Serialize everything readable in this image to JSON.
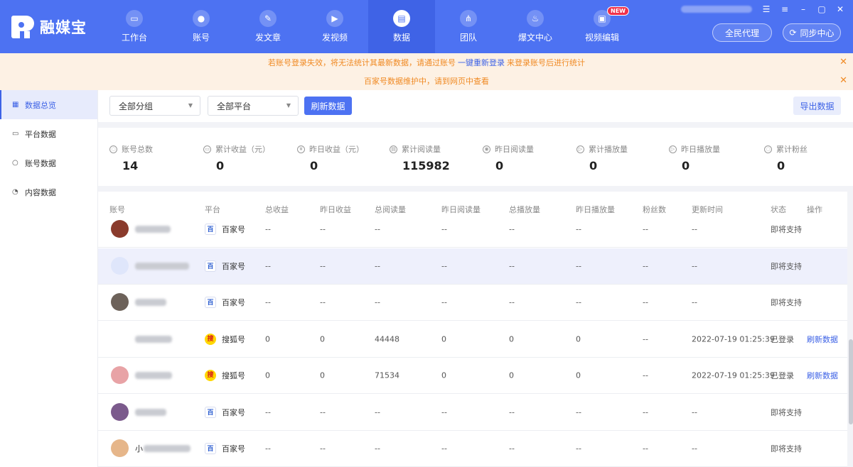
{
  "app": {
    "logo_text": "融媒宝"
  },
  "header": {
    "nav": [
      {
        "label": "工作台",
        "icon": "desktop-icon",
        "glyph": "▭"
      },
      {
        "label": "账号",
        "icon": "user-icon",
        "glyph": "●"
      },
      {
        "label": "发文章",
        "icon": "feather-icon",
        "glyph": "✎"
      },
      {
        "label": "发视频",
        "icon": "play-icon",
        "glyph": "▶"
      },
      {
        "label": "数据",
        "icon": "chart-icon",
        "glyph": "▤"
      },
      {
        "label": "团队",
        "icon": "team-icon",
        "glyph": "⋔"
      },
      {
        "label": "爆文中心",
        "icon": "flame-icon",
        "glyph": "♨"
      },
      {
        "label": "视频编辑",
        "icon": "briefcase-icon",
        "glyph": "▣"
      }
    ],
    "new_badge": "NEW",
    "agent_button": "全民代理",
    "sync_button": "同步中心"
  },
  "notices": {
    "login_pre": "若账号登录失效，将无法统计其最新数据，请通过账号",
    "login_link": "一键重新登录",
    "login_post": "来登录账号后进行统计",
    "maintenance": "百家号数据维护中，请到网页中查看"
  },
  "sidebar": {
    "items": [
      {
        "label": "数据总览"
      },
      {
        "label": "平台数据"
      },
      {
        "label": "账号数据"
      },
      {
        "label": "内容数据"
      }
    ]
  },
  "filters": {
    "group": "全部分组",
    "platform": "全部平台",
    "refresh": "刷新数据",
    "export": "导出数据"
  },
  "stats": [
    {
      "label": "账号总数",
      "value": "14"
    },
    {
      "label": "累计收益（元）",
      "value": "0"
    },
    {
      "label": "昨日收益（元）",
      "value": "0"
    },
    {
      "label": "累计阅读量",
      "value": "115982"
    },
    {
      "label": "昨日阅读量",
      "value": "0"
    },
    {
      "label": "累计播放量",
      "value": "0"
    },
    {
      "label": "昨日播放量",
      "value": "0"
    },
    {
      "label": "累计粉丝",
      "value": "0"
    }
  ],
  "table": {
    "columns": [
      "账号",
      "平台",
      "总收益",
      "昨日收益",
      "总阅读量",
      "昨日阅读量",
      "总播放量",
      "昨日播放量",
      "粉丝数",
      "更新时间",
      "状态",
      "操作"
    ],
    "rows": [
      {
        "name_prefix": "",
        "platform": "百家号",
        "pf": "bj",
        "total_income": "--",
        "yesterday_income": "--",
        "total_reads": "--",
        "yesterday_reads": "--",
        "total_plays": "--",
        "yesterday_plays": "--",
        "fans": "--",
        "updated": "--",
        "status": "即将支持",
        "action": "",
        "avatar_color": "#8a3b2c"
      },
      {
        "name_prefix": "",
        "platform": "百家号",
        "pf": "bj",
        "total_income": "--",
        "yesterday_income": "--",
        "total_reads": "--",
        "yesterday_reads": "--",
        "total_plays": "--",
        "yesterday_plays": "--",
        "fans": "--",
        "updated": "--",
        "status": "即将支持",
        "action": "",
        "avatar_color": "#dfe6fb"
      },
      {
        "name_prefix": "",
        "platform": "百家号",
        "pf": "bj",
        "total_income": "--",
        "yesterday_income": "--",
        "total_reads": "--",
        "yesterday_reads": "--",
        "total_plays": "--",
        "yesterday_plays": "--",
        "fans": "--",
        "updated": "--",
        "status": "即将支持",
        "action": "",
        "avatar_color": "#6d625a"
      },
      {
        "name_prefix": "",
        "platform": "搜狐号",
        "pf": "sh",
        "total_income": "0",
        "yesterday_income": "0",
        "total_reads": "44448",
        "yesterday_reads": "0",
        "total_plays": "0",
        "yesterday_plays": "0",
        "fans": "--",
        "updated": "2022-07-19 01:25:39",
        "status": "已登录",
        "action": "刷新数据",
        "avatar_color": ""
      },
      {
        "name_prefix": "",
        "platform": "搜狐号",
        "pf": "sh",
        "total_income": "0",
        "yesterday_income": "0",
        "total_reads": "71534",
        "yesterday_reads": "0",
        "total_plays": "0",
        "yesterday_plays": "0",
        "fans": "--",
        "updated": "2022-07-19 01:25:39",
        "status": "已登录",
        "action": "刷新数据",
        "avatar_color": "#e8a3a6"
      },
      {
        "name_prefix": "",
        "platform": "百家号",
        "pf": "bj",
        "total_income": "--",
        "yesterday_income": "--",
        "total_reads": "--",
        "yesterday_reads": "--",
        "total_plays": "--",
        "yesterday_plays": "--",
        "fans": "--",
        "updated": "--",
        "status": "即将支持",
        "action": "",
        "avatar_color": "#7b5a8c"
      },
      {
        "name_prefix": "小",
        "platform": "百家号",
        "pf": "bj",
        "total_income": "--",
        "yesterday_income": "--",
        "total_reads": "--",
        "yesterday_reads": "--",
        "total_plays": "--",
        "yesterday_plays": "--",
        "fans": "--",
        "updated": "--",
        "status": "即将支持",
        "action": "",
        "avatar_color": "#e6b68a"
      }
    ]
  },
  "platform_icons": {
    "bj": "百",
    "sh": "搜"
  },
  "colors": {
    "primary": "#4d72f2",
    "notice_text": "#f08a24",
    "link": "#3d62e6"
  }
}
